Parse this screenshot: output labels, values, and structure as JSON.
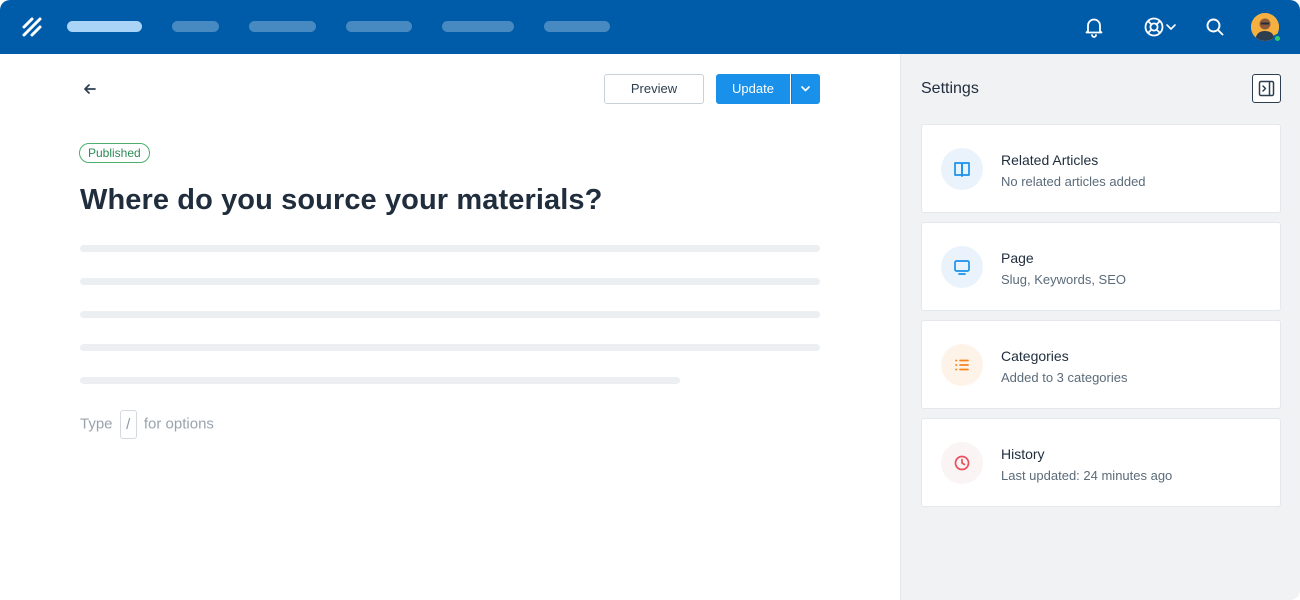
{
  "header": {
    "nav_items": [
      "",
      "",
      "",
      "",
      "",
      ""
    ],
    "icons": [
      "logo-icon",
      "bell-icon",
      "lifebuoy-icon",
      "chevron-down-icon",
      "search-icon",
      "avatar"
    ]
  },
  "toolbar": {
    "preview_label": "Preview",
    "update_label": "Update"
  },
  "article": {
    "status": "Published",
    "title": "Where do you source your materials?",
    "hint_prefix": "Type",
    "hint_key": "/",
    "hint_suffix": "for options"
  },
  "settings": {
    "title": "Settings",
    "cards": [
      {
        "title": "Related Articles",
        "subtitle": "No related articles added",
        "icon": "book-icon",
        "color": "#1991eb"
      },
      {
        "title": "Page",
        "subtitle": "Slug, Keywords, SEO",
        "icon": "monitor-icon",
        "color": "#1991eb"
      },
      {
        "title": "Categories",
        "subtitle": "Added to 3 categories",
        "icon": "list-icon",
        "color": "#f5841f"
      },
      {
        "title": "History",
        "subtitle": "Last updated: 24 minutes ago",
        "icon": "clock-icon",
        "color": "#e8505b"
      }
    ]
  },
  "colors": {
    "topbar": "#005ca9",
    "accent": "#1991eb",
    "published": "#2e8b57"
  }
}
